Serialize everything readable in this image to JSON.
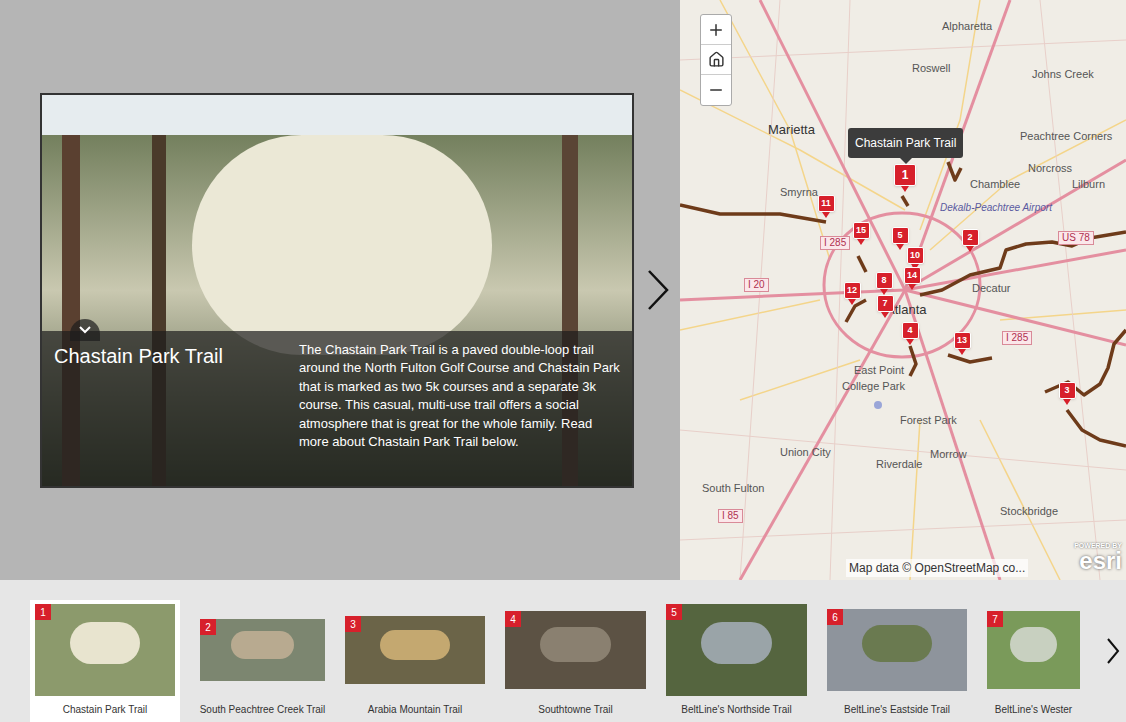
{
  "tour": {
    "current": {
      "number": "1",
      "title": "Chastain Park Trail",
      "description": "The Chastain Park Trail is a paved double-loop trail around the North Fulton Golf Course and Chastain Park that is marked as two 5k courses and a separate 3k course. This casual, multi-use trail offers a social atmosphere that is great for the whole family. Read more about Chastain Park Trail below."
    }
  },
  "map": {
    "tooltip": "Chastain Park Trail",
    "pins": [
      {
        "label": "1",
        "selected": true
      },
      {
        "label": "2",
        "selected": false
      },
      {
        "label": "3",
        "selected": false
      },
      {
        "label": "4",
        "selected": false
      },
      {
        "label": "5",
        "selected": false
      },
      {
        "label": "7",
        "selected": false
      },
      {
        "label": "8",
        "selected": false
      },
      {
        "label": "10",
        "selected": false
      },
      {
        "label": "11",
        "selected": false
      },
      {
        "label": "12",
        "selected": false
      },
      {
        "label": "13",
        "selected": false
      },
      {
        "label": "14",
        "selected": false
      },
      {
        "label": "15",
        "selected": false
      }
    ],
    "labels": [
      {
        "text": "Alpharetta",
        "kind": "city"
      },
      {
        "text": "Roswell",
        "kind": "city"
      },
      {
        "text": "Johns Creek",
        "kind": "city"
      },
      {
        "text": "Peachtree Corners",
        "kind": "city"
      },
      {
        "text": "Norcross",
        "kind": "city"
      },
      {
        "text": "Marietta",
        "kind": "major"
      },
      {
        "text": "Smyrna",
        "kind": "city"
      },
      {
        "text": "Chamblee",
        "kind": "city"
      },
      {
        "text": "Lilburn",
        "kind": "city"
      },
      {
        "text": "Dekalb-Peachtree Airport",
        "kind": "airport"
      },
      {
        "text": "Decatur",
        "kind": "city"
      },
      {
        "text": "Atlanta",
        "kind": "major"
      },
      {
        "text": "East Point",
        "kind": "city"
      },
      {
        "text": "College Park",
        "kind": "city"
      },
      {
        "text": "Forest Park",
        "kind": "city"
      },
      {
        "text": "Riverdale",
        "kind": "city"
      },
      {
        "text": "Morrow",
        "kind": "city"
      },
      {
        "text": "Union City",
        "kind": "city"
      },
      {
        "text": "South Fulton",
        "kind": "city"
      },
      {
        "text": "Stockbridge",
        "kind": "city"
      },
      {
        "text": "I 285",
        "kind": "road"
      },
      {
        "text": "I 20",
        "kind": "road"
      },
      {
        "text": "US 78",
        "kind": "road"
      },
      {
        "text": "I 285",
        "kind": "road"
      },
      {
        "text": "I 85",
        "kind": "road"
      }
    ],
    "attribution": "Map data © OpenStreetMap co...",
    "logo": {
      "powered_by": "POWERED BY",
      "name": "esri"
    }
  },
  "carousel": {
    "items": [
      {
        "number": "1",
        "title": "Chastain Park Trail",
        "selected": true
      },
      {
        "number": "2",
        "title": "South Peachtree Creek Trail",
        "selected": false
      },
      {
        "number": "3",
        "title": "Arabia Mountain Trail",
        "selected": false
      },
      {
        "number": "4",
        "title": "Southtowne Trail",
        "selected": false
      },
      {
        "number": "5",
        "title": "BeltLine's Northside Trail",
        "selected": false
      },
      {
        "number": "6",
        "title": "BeltLine's Eastside Trail",
        "selected": false
      },
      {
        "number": "7",
        "title": "BeltLine's Wester",
        "selected": false
      }
    ]
  }
}
